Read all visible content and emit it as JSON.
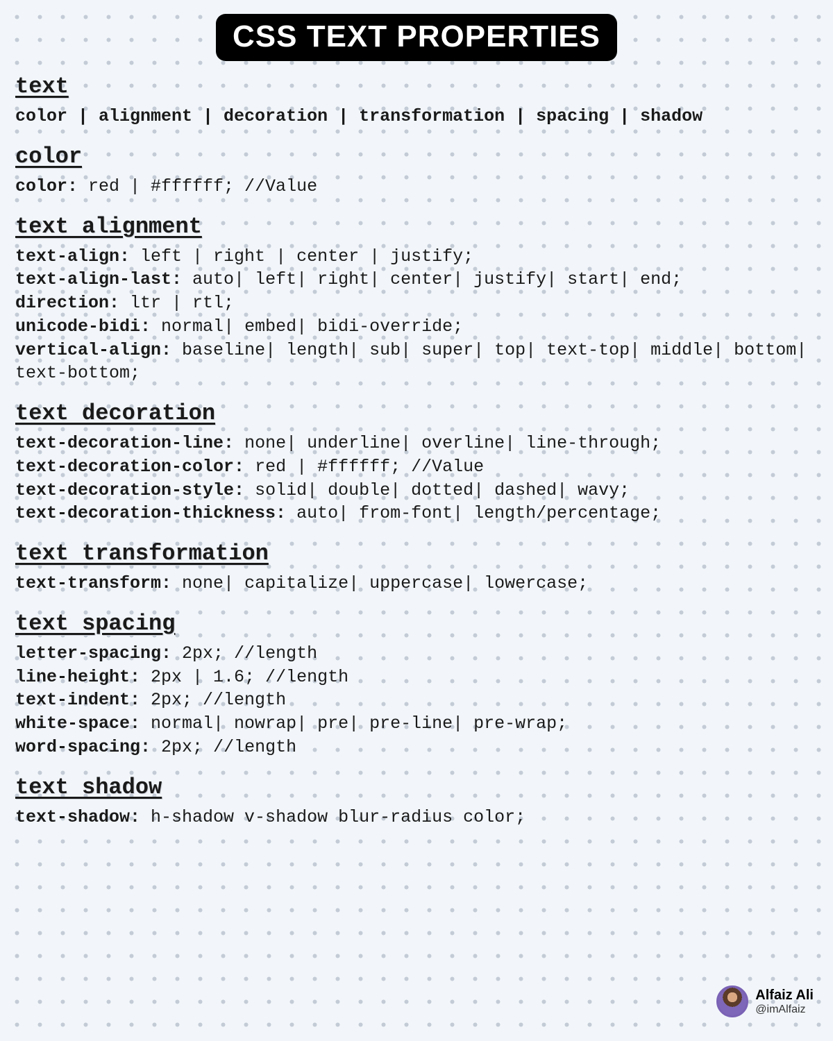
{
  "title": "CSS TEXT PROPERTIES",
  "intro": {
    "heading": "text",
    "categories": "color | alignment | decoration | transformation | spacing | shadow"
  },
  "sections": [
    {
      "heading": "color",
      "lines": [
        {
          "prop": "color:",
          "rest": " red | #ffffff; //Value"
        }
      ]
    },
    {
      "heading": "text alignment",
      "lines": [
        {
          "prop": "text-align:",
          "rest": " left | right | center | justify;"
        },
        {
          "prop": "text-align-last:",
          "rest": " auto| left| right| center| justify| start| end;"
        },
        {
          "prop": "direction:",
          "rest": " ltr | rtl;"
        },
        {
          "prop": "unicode-bidi:",
          "rest": " normal| embed| bidi-override;"
        },
        {
          "prop": "vertical-align:",
          "rest": " baseline| length| sub| super| top| text-top| middle| bottom| text-bottom;"
        }
      ]
    },
    {
      "heading": "text decoration",
      "lines": [
        {
          "prop": "text-decoration-line:",
          "rest": " none| underline| overline| line-through;"
        },
        {
          "prop": "text-decoration-color:",
          "rest": " red | #ffffff; //Value"
        },
        {
          "prop": "text-decoration-style:",
          "rest": " solid| double| dotted| dashed| wavy;"
        },
        {
          "prop": "text-decoration-thickness:",
          "rest": " auto| from-font| length/percentage;"
        }
      ]
    },
    {
      "heading": "text transformation",
      "lines": [
        {
          "prop": "text-transform:",
          "rest": " none| capitalize| uppercase| lowercase;"
        }
      ]
    },
    {
      "heading": "text spacing",
      "lines": [
        {
          "prop": "letter-spacing:",
          "rest": " 2px; //length"
        },
        {
          "prop": "line-height:",
          "rest": " 2px | 1.6; //length"
        },
        {
          "prop": "text-indent:",
          "rest": " 2px; //length"
        },
        {
          "prop": "white-space:",
          "rest": " normal| nowrap| pre| pre-line| pre-wrap;"
        },
        {
          "prop": "word-spacing:",
          "rest": " 2px; //length"
        }
      ]
    },
    {
      "heading": "text shadow",
      "lines": [
        {
          "prop": "text-shadow:",
          "rest": " h-shadow v-shadow blur-radius color;"
        }
      ]
    }
  ],
  "attribution": {
    "name": "Alfaiz Ali",
    "handle": "@imAlfaiz"
  }
}
